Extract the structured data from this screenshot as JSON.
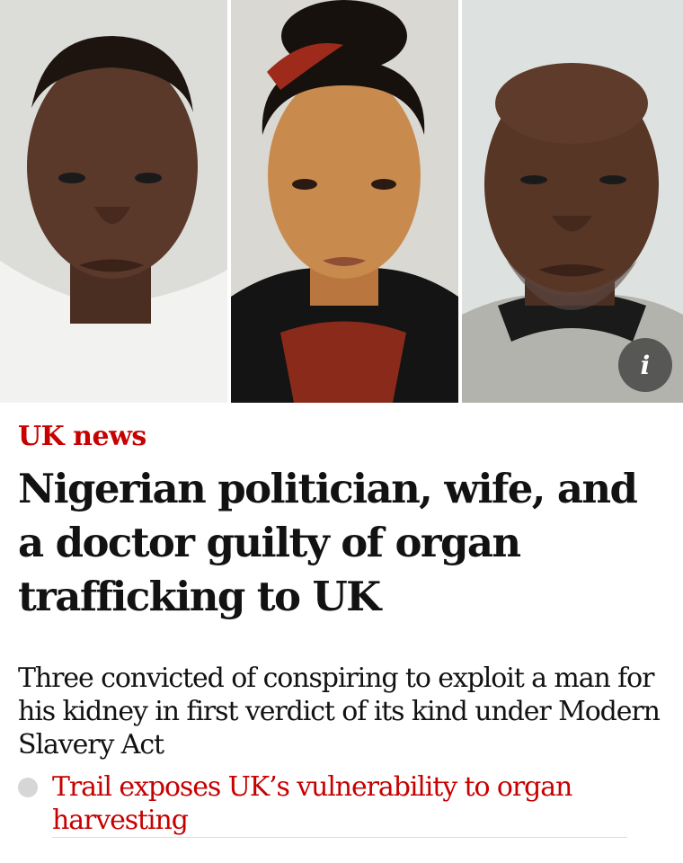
{
  "section": {
    "label": "UK news"
  },
  "article": {
    "headline": "Nigerian politician, wife, and a doctor guilty of organ trafficking to UK",
    "standfirst": "Three convicted of conspiring to exploit a man for his kidney in first verdict of its kind under Modern Slavery Act"
  },
  "related": {
    "link_text": "Trail exposes UK’s vulnerability to organ harvesting"
  },
  "image": {
    "info_icon": "i"
  },
  "colors": {
    "accent": "#c70000",
    "text": "#121212",
    "bullet": "#d6d6d6"
  },
  "icons": {
    "info": "info-icon",
    "bullet": "bullet-dot-icon"
  }
}
